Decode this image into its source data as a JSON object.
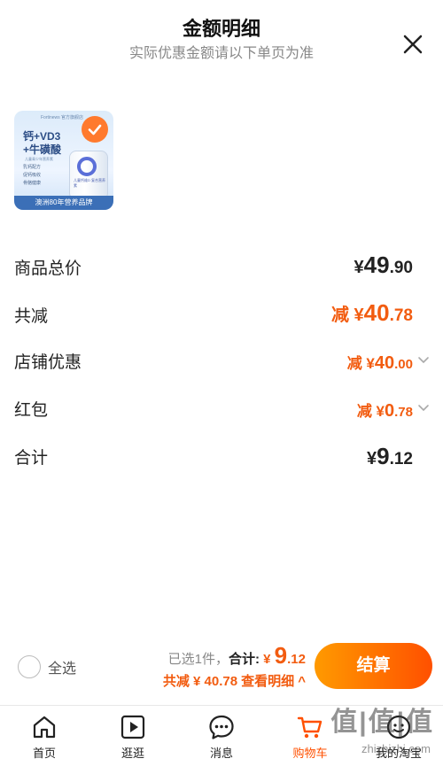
{
  "header": {
    "title": "金额明细",
    "subtitle": "实际优惠金额请以下单页为准"
  },
  "product": {
    "brand": "Fortinews 官方旗舰店",
    "line1": "钙+VD3",
    "line2": "+牛磺酸",
    "small": "儿童青少年营养素",
    "bullets": [
      "乳钙配方",
      "促钙吸收",
      "骨骼健康"
    ],
    "bottle_label": "儿童钙维D\n复合营养素",
    "banner": "澳洲80年营养品牌",
    "selected": true
  },
  "rows": [
    {
      "label": "商品总价",
      "prefix": "",
      "yen": "¥",
      "int": "49",
      "dec": ".90",
      "style": "plain",
      "size": "big",
      "expandable": false
    },
    {
      "label": "共减",
      "prefix": "减 ",
      "yen": "¥",
      "int": "40",
      "dec": ".78",
      "style": "orange",
      "size": "big",
      "expandable": false
    },
    {
      "label": "店铺优惠",
      "prefix": "减 ",
      "yen": "¥",
      "int": "40",
      "dec": ".00",
      "style": "orange",
      "size": "mid",
      "expandable": true
    },
    {
      "label": "红包",
      "prefix": "减 ",
      "yen": "¥",
      "int": "0",
      "dec": ".78",
      "style": "orange",
      "size": "mid",
      "expandable": true
    },
    {
      "label": "合计",
      "prefix": "",
      "yen": "¥",
      "int": "9",
      "dec": ".12",
      "style": "plain",
      "size": "big",
      "expandable": false
    }
  ],
  "checkout": {
    "select_all": "全选",
    "selected_count": "已选1件，",
    "total_label": "合计: ",
    "total_yen": "¥ ",
    "total_int": "9",
    "total_dec": ".12",
    "discount_text": "共减 ¥ 40.78",
    "detail_link": "查看明细 ^",
    "pay_button": "结算"
  },
  "tabbar": [
    {
      "label": "首页",
      "icon": "home-icon",
      "active": false
    },
    {
      "label": "逛逛",
      "icon": "play-icon",
      "active": false
    },
    {
      "label": "消息",
      "icon": "message-icon",
      "active": false
    },
    {
      "label": "购物车",
      "icon": "cart-icon",
      "active": true
    },
    {
      "label": "我的淘宝",
      "icon": "profile-icon",
      "active": false
    }
  ],
  "watermark": {
    "main": "值|值|值",
    "sub": "zhizhizhi.com"
  },
  "colors": {
    "accent": "#ff5000",
    "discount": "#f25c10",
    "pay_gradient_start": "#ff9a00",
    "pay_gradient_end": "#ff5000"
  }
}
